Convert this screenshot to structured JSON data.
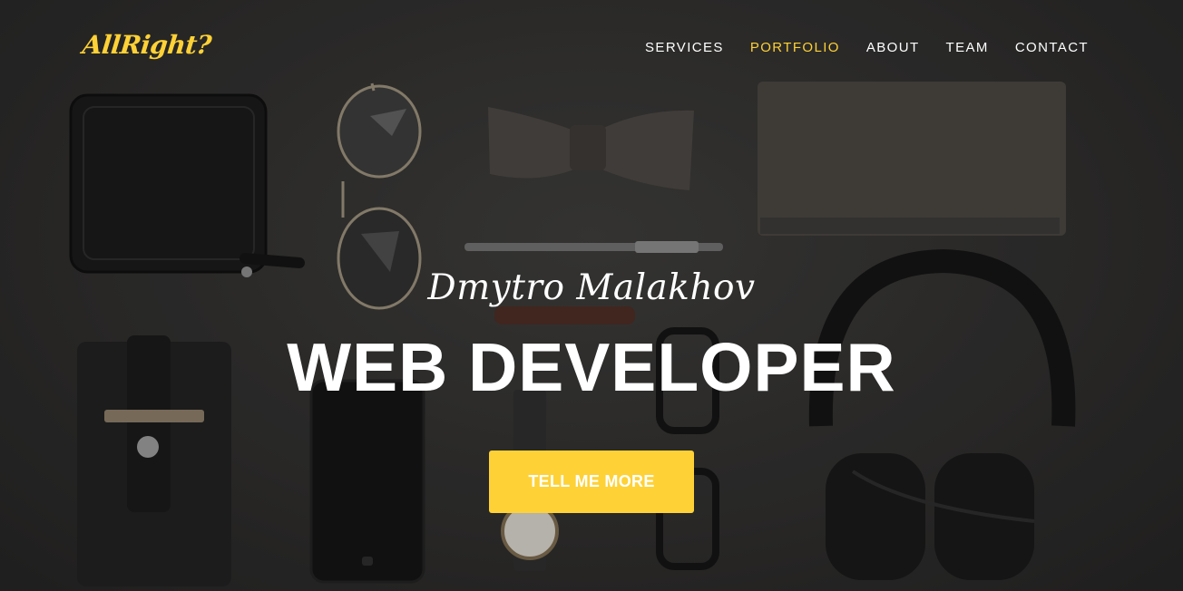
{
  "brand": {
    "logo_text": "AllRight?",
    "accent_color": "#fed136"
  },
  "nav": {
    "items": [
      {
        "label": "SERVICES",
        "active": false
      },
      {
        "label": "PORTFOLIO",
        "active": true
      },
      {
        "label": "ABOUT",
        "active": false
      },
      {
        "label": "TEAM",
        "active": false
      },
      {
        "label": "CONTACT",
        "active": false
      }
    ]
  },
  "hero": {
    "subtitle": "Dmytro Malakhov",
    "headline": "WEB DEVELOPER",
    "cta_label": "TELL ME MORE",
    "background_image": "flat-lay of dark accessories: wallet, aviator sunglasses, bow tie, notebook, pen, headphones, phone, card holder, watch, glasses"
  }
}
